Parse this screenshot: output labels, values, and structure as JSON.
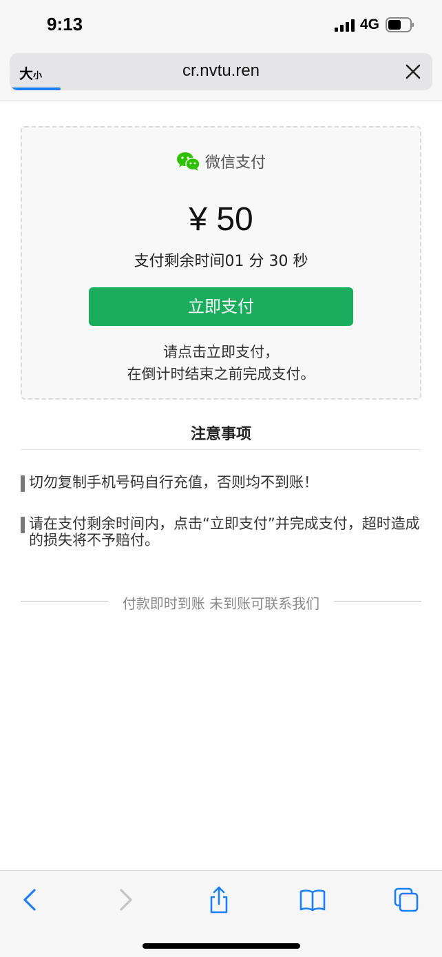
{
  "status_bar": {
    "time": "9:13",
    "network": "4G"
  },
  "browser": {
    "text_size_big": "大",
    "text_size_small": "小",
    "url": "cr.nvtu.ren"
  },
  "payment": {
    "method": "微信支付",
    "amount": "¥ 50",
    "countdown": "支付剩余时间01 分 30 秒",
    "pay_button": "立即支付",
    "hint_line1": "请点击立即支付，",
    "hint_line2": "在倒计时结束之前完成支付。"
  },
  "notice": {
    "title": "注意事项",
    "items": [
      "切勿复制手机号码自行充值，否则均不到账！",
      "请在支付剩余时间内，点击“立即支付”并完成支付，超时造成的损失将不予赔付。"
    ]
  },
  "footer": {
    "text": "付款即时到账 未到账可联系我们"
  },
  "colors": {
    "wechat_green": "#1aad5e",
    "ios_blue": "#1a7ff5",
    "progress_blue": "#1a7ff5"
  },
  "toolbar_icons": [
    "back-icon",
    "forward-icon",
    "share-icon",
    "bookmarks-icon",
    "tabs-icon"
  ]
}
